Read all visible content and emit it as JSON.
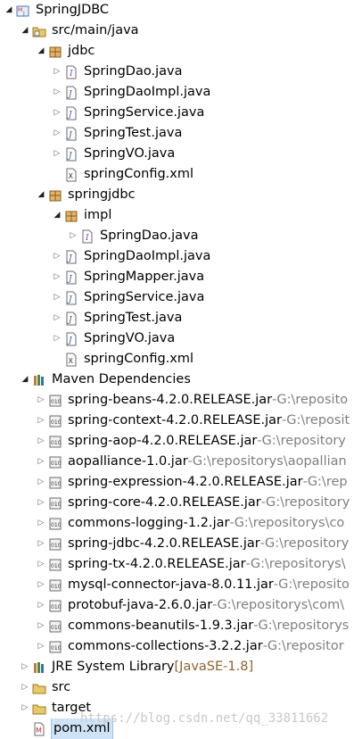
{
  "tree": [
    {
      "level": 0,
      "toggle": "open",
      "icon": "maven-project-icon",
      "label": "SpringJDBC"
    },
    {
      "level": 1,
      "toggle": "open",
      "icon": "source-folder-icon",
      "label": "src/main/java"
    },
    {
      "level": 2,
      "toggle": "open",
      "icon": "package-icon",
      "label": "jdbc"
    },
    {
      "level": 3,
      "toggle": "closed",
      "icon": "interface-file-icon",
      "label": "SpringDao.java"
    },
    {
      "level": 3,
      "toggle": "closed",
      "icon": "java-file-icon",
      "label": "SpringDaoImpl.java"
    },
    {
      "level": 3,
      "toggle": "closed",
      "icon": "java-file-icon",
      "label": "SpringService.java"
    },
    {
      "level": 3,
      "toggle": "closed",
      "icon": "java-file-icon",
      "label": "SpringTest.java"
    },
    {
      "level": 3,
      "toggle": "closed",
      "icon": "java-file-icon",
      "label": "SpringVO.java"
    },
    {
      "level": 3,
      "toggle": "none",
      "icon": "xml-file-icon",
      "label": "springConfig.xml"
    },
    {
      "level": 2,
      "toggle": "open",
      "icon": "package-icon",
      "label": "springjdbc"
    },
    {
      "level": 3,
      "toggle": "open",
      "icon": "package-icon",
      "label": "impl"
    },
    {
      "level": 4,
      "toggle": "closed",
      "icon": "interface-file-icon",
      "label": "SpringDao.java"
    },
    {
      "level": 3,
      "toggle": "closed",
      "icon": "java-file-icon",
      "label": "SpringDaoImpl.java"
    },
    {
      "level": 3,
      "toggle": "closed",
      "icon": "java-file-icon",
      "label": "SpringMapper.java"
    },
    {
      "level": 3,
      "toggle": "closed",
      "icon": "java-file-icon",
      "label": "SpringService.java"
    },
    {
      "level": 3,
      "toggle": "closed",
      "icon": "java-file-icon",
      "label": "SpringTest.java"
    },
    {
      "level": 3,
      "toggle": "closed",
      "icon": "java-file-icon",
      "label": "SpringVO.java"
    },
    {
      "level": 3,
      "toggle": "none",
      "icon": "xml-file-icon",
      "label": "springConfig.xml"
    },
    {
      "level": 1,
      "toggle": "open",
      "icon": "library-icon",
      "label": "Maven Dependencies"
    },
    {
      "level": 2,
      "toggle": "closed",
      "icon": "jar-icon",
      "label": "spring-beans-4.2.0.RELEASE.jar",
      "path": "G:\\reposito"
    },
    {
      "level": 2,
      "toggle": "closed",
      "icon": "jar-icon",
      "label": "spring-context-4.2.0.RELEASE.jar",
      "path": "G:\\reposit"
    },
    {
      "level": 2,
      "toggle": "closed",
      "icon": "jar-icon",
      "label": "spring-aop-4.2.0.RELEASE.jar",
      "path": "G:\\repository"
    },
    {
      "level": 2,
      "toggle": "closed",
      "icon": "jar-icon",
      "label": "aopalliance-1.0.jar",
      "path": "G:\\repositorys\\aopallian"
    },
    {
      "level": 2,
      "toggle": "closed",
      "icon": "jar-icon",
      "label": "spring-expression-4.2.0.RELEASE.jar",
      "path": "G:\\rep"
    },
    {
      "level": 2,
      "toggle": "closed",
      "icon": "jar-icon",
      "label": "spring-core-4.2.0.RELEASE.jar",
      "path": "G:\\repository"
    },
    {
      "level": 2,
      "toggle": "closed",
      "icon": "jar-icon",
      "label": "commons-logging-1.2.jar",
      "path": "G:\\repositorys\\co"
    },
    {
      "level": 2,
      "toggle": "closed",
      "icon": "jar-icon",
      "label": "spring-jdbc-4.2.0.RELEASE.jar",
      "path": "G:\\repository"
    },
    {
      "level": 2,
      "toggle": "closed",
      "icon": "jar-icon",
      "label": "spring-tx-4.2.0.RELEASE.jar",
      "path": "G:\\repositorys\\"
    },
    {
      "level": 2,
      "toggle": "closed",
      "icon": "jar-icon",
      "label": "mysql-connector-java-8.0.11.jar",
      "path": "G:\\reposito"
    },
    {
      "level": 2,
      "toggle": "closed",
      "icon": "jar-icon",
      "label": "protobuf-java-2.6.0.jar",
      "path": "G:\\repositorys\\com\\"
    },
    {
      "level": 2,
      "toggle": "closed",
      "icon": "jar-icon",
      "label": "commons-beanutils-1.9.3.jar",
      "path": "G:\\repositorys"
    },
    {
      "level": 2,
      "toggle": "closed",
      "icon": "jar-icon",
      "label": "commons-collections-3.2.2.jar",
      "path": "G:\\repositor"
    },
    {
      "level": 1,
      "toggle": "closed",
      "icon": "library-icon",
      "label": "JRE System Library",
      "version": "[JavaSE-1.8]"
    },
    {
      "level": 1,
      "toggle": "closed",
      "icon": "folder-icon",
      "label": "src"
    },
    {
      "level": 1,
      "toggle": "closed",
      "icon": "folder-icon",
      "label": "target"
    },
    {
      "level": 1,
      "toggle": "none",
      "icon": "maven-pom-icon",
      "label": "pom.xml",
      "selected": true
    }
  ],
  "watermark": "https://blog.csdn.net/qq_33811662",
  "colors": {
    "selection": "#cfe3f6",
    "decoration": "#7f7f7f",
    "version": "#906030"
  }
}
